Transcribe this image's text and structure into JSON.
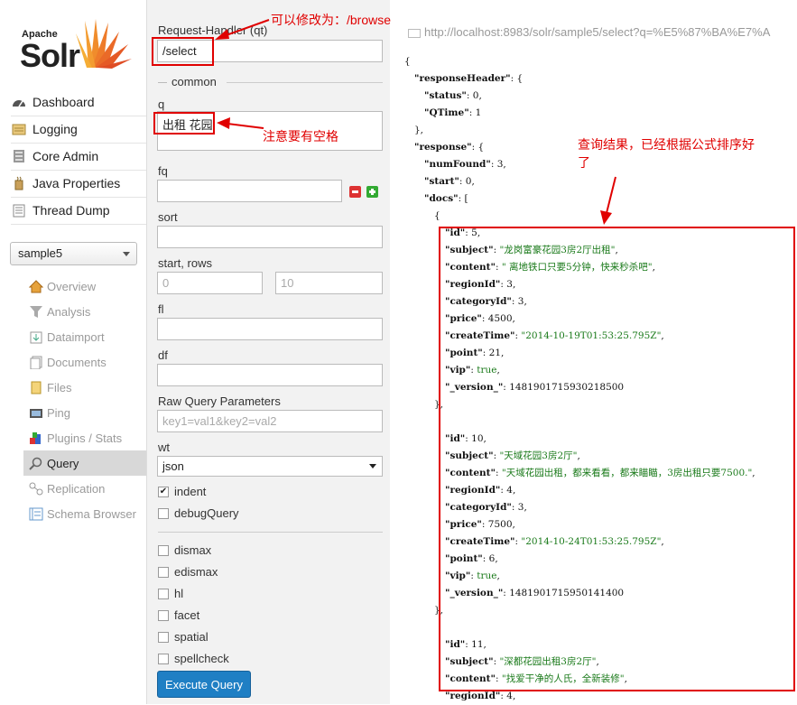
{
  "logo": {
    "top": "Apache",
    "main": "Solr"
  },
  "nav": [
    {
      "label": "Dashboard",
      "icon": "dashboard-icon"
    },
    {
      "label": "Logging",
      "icon": "logging-icon"
    },
    {
      "label": "Core Admin",
      "icon": "core-admin-icon"
    },
    {
      "label": "Java Properties",
      "icon": "java-icon"
    },
    {
      "label": "Thread Dump",
      "icon": "thread-dump-icon"
    }
  ],
  "core_selector": {
    "value": "sample5"
  },
  "core_menu": [
    {
      "label": "Overview",
      "icon": "home-icon"
    },
    {
      "label": "Analysis",
      "icon": "filter-icon"
    },
    {
      "label": "Dataimport",
      "icon": "dataimport-icon"
    },
    {
      "label": "Documents",
      "icon": "documents-icon"
    },
    {
      "label": "Files",
      "icon": "folder-icon"
    },
    {
      "label": "Ping",
      "icon": "ping-icon"
    },
    {
      "label": "Plugins / Stats",
      "icon": "plugins-icon"
    },
    {
      "label": "Query",
      "icon": "search-icon",
      "active": true
    },
    {
      "label": "Replication",
      "icon": "replication-icon"
    },
    {
      "label": "Schema Browser",
      "icon": "schema-icon"
    }
  ],
  "form": {
    "qt_label": "Request-Handler (qt)",
    "qt_value": "/select",
    "common_label": "common",
    "q_label": "q",
    "q_value": "出租 花园",
    "fq_label": "fq",
    "sort_label": "sort",
    "start_rows_label": "start, rows",
    "start_placeholder": "0",
    "rows_placeholder": "10",
    "fl_label": "fl",
    "df_label": "df",
    "raw_label": "Raw Query Parameters",
    "raw_placeholder": "key1=val1&key2=val2",
    "wt_label": "wt",
    "wt_value": "json",
    "indent_label": "indent",
    "debug_label": "debugQuery",
    "dismax_label": "dismax",
    "edismax_label": "edismax",
    "hl_label": "hl",
    "facet_label": "facet",
    "spatial_label": "spatial",
    "spellcheck_label": "spellcheck",
    "execute_label": "Execute Query"
  },
  "response_url": "http://localhost:8983/solr/sample5/select?q=%E5%87%BA%E7%A",
  "json_lines": [
    {
      "indent": 0,
      "parts": [
        [
          "p",
          "{"
        ]
      ]
    },
    {
      "indent": 1,
      "parts": [
        [
          "k",
          "\"responseHeader\""
        ],
        [
          "p",
          ": {"
        ]
      ]
    },
    {
      "indent": 2,
      "parts": [
        [
          "k",
          "\"status\""
        ],
        [
          "p",
          ": "
        ],
        [
          "n",
          "0"
        ],
        [
          "p",
          ","
        ]
      ]
    },
    {
      "indent": 2,
      "parts": [
        [
          "k",
          "\"QTime\""
        ],
        [
          "p",
          ": "
        ],
        [
          "n",
          "1"
        ]
      ]
    },
    {
      "indent": 1,
      "parts": [
        [
          "p",
          "},"
        ]
      ]
    },
    {
      "indent": 1,
      "parts": [
        [
          "k",
          "\"response\""
        ],
        [
          "p",
          ": {"
        ]
      ]
    },
    {
      "indent": 2,
      "parts": [
        [
          "k",
          "\"numFound\""
        ],
        [
          "p",
          ": "
        ],
        [
          "n",
          "3"
        ],
        [
          "p",
          ","
        ]
      ]
    },
    {
      "indent": 2,
      "parts": [
        [
          "k",
          "\"start\""
        ],
        [
          "p",
          ": "
        ],
        [
          "n",
          "0"
        ],
        [
          "p",
          ","
        ]
      ]
    },
    {
      "indent": 2,
      "parts": [
        [
          "k",
          "\"docs\""
        ],
        [
          "p",
          ": ["
        ]
      ]
    },
    {
      "indent": 3,
      "parts": [
        [
          "p",
          "{"
        ]
      ]
    },
    {
      "indent": 4,
      "parts": [
        [
          "k",
          "\"id\""
        ],
        [
          "p",
          ": "
        ],
        [
          "n",
          "5"
        ],
        [
          "p",
          ","
        ]
      ]
    },
    {
      "indent": 4,
      "parts": [
        [
          "k",
          "\"subject\""
        ],
        [
          "p",
          ": "
        ],
        [
          "s",
          "\"龙岗富豪花园3房2厅出租\""
        ],
        [
          "p",
          ","
        ]
      ]
    },
    {
      "indent": 4,
      "parts": [
        [
          "k",
          "\"content\""
        ],
        [
          "p",
          ": "
        ],
        [
          "s",
          "\" 离地铁口只要5分钟，快来秒杀吧\""
        ],
        [
          "p",
          ","
        ]
      ]
    },
    {
      "indent": 4,
      "parts": [
        [
          "k",
          "\"regionId\""
        ],
        [
          "p",
          ": "
        ],
        [
          "n",
          "3"
        ],
        [
          "p",
          ","
        ]
      ]
    },
    {
      "indent": 4,
      "parts": [
        [
          "k",
          "\"categoryId\""
        ],
        [
          "p",
          ": "
        ],
        [
          "n",
          "3"
        ],
        [
          "p",
          ","
        ]
      ]
    },
    {
      "indent": 4,
      "parts": [
        [
          "k",
          "\"price\""
        ],
        [
          "p",
          ": "
        ],
        [
          "n",
          "4500"
        ],
        [
          "p",
          ","
        ]
      ]
    },
    {
      "indent": 4,
      "parts": [
        [
          "k",
          "\"createTime\""
        ],
        [
          "p",
          ": "
        ],
        [
          "s",
          "\"2014-10-19T01:53:25.795Z\""
        ],
        [
          "p",
          ","
        ]
      ]
    },
    {
      "indent": 4,
      "parts": [
        [
          "k",
          "\"point\""
        ],
        [
          "p",
          ": "
        ],
        [
          "n",
          "21"
        ],
        [
          "p",
          ","
        ]
      ]
    },
    {
      "indent": 4,
      "parts": [
        [
          "k",
          "\"vip\""
        ],
        [
          "p",
          ": "
        ],
        [
          "s",
          "true"
        ],
        [
          "p",
          ","
        ]
      ]
    },
    {
      "indent": 4,
      "parts": [
        [
          "k",
          "\"_version_\""
        ],
        [
          "p",
          ": "
        ],
        [
          "n",
          "1481901715930218500"
        ]
      ]
    },
    {
      "indent": 3,
      "parts": [
        [
          "p",
          "},"
        ]
      ]
    },
    {
      "indent": 3,
      "parts": [
        [
          "p",
          ""
        ]
      ]
    },
    {
      "indent": 4,
      "parts": [
        [
          "k",
          "\"id\""
        ],
        [
          "p",
          ": "
        ],
        [
          "n",
          "10"
        ],
        [
          "p",
          ","
        ]
      ]
    },
    {
      "indent": 4,
      "parts": [
        [
          "k",
          "\"subject\""
        ],
        [
          "p",
          ": "
        ],
        [
          "s",
          "\"天域花园3房2厅\""
        ],
        [
          "p",
          ","
        ]
      ]
    },
    {
      "indent": 4,
      "parts": [
        [
          "k",
          "\"content\""
        ],
        [
          "p",
          ": "
        ],
        [
          "s",
          "\"天域花园出租，都来看看，都来瞄瞄，3房出租只要7500.\""
        ],
        [
          "p",
          ","
        ]
      ]
    },
    {
      "indent": 4,
      "parts": [
        [
          "k",
          "\"regionId\""
        ],
        [
          "p",
          ": "
        ],
        [
          "n",
          "4"
        ],
        [
          "p",
          ","
        ]
      ]
    },
    {
      "indent": 4,
      "parts": [
        [
          "k",
          "\"categoryId\""
        ],
        [
          "p",
          ": "
        ],
        [
          "n",
          "3"
        ],
        [
          "p",
          ","
        ]
      ]
    },
    {
      "indent": 4,
      "parts": [
        [
          "k",
          "\"price\""
        ],
        [
          "p",
          ": "
        ],
        [
          "n",
          "7500"
        ],
        [
          "p",
          ","
        ]
      ]
    },
    {
      "indent": 4,
      "parts": [
        [
          "k",
          "\"createTime\""
        ],
        [
          "p",
          ": "
        ],
        [
          "s",
          "\"2014-10-24T01:53:25.795Z\""
        ],
        [
          "p",
          ","
        ]
      ]
    },
    {
      "indent": 4,
      "parts": [
        [
          "k",
          "\"point\""
        ],
        [
          "p",
          ": "
        ],
        [
          "n",
          "6"
        ],
        [
          "p",
          ","
        ]
      ]
    },
    {
      "indent": 4,
      "parts": [
        [
          "k",
          "\"vip\""
        ],
        [
          "p",
          ": "
        ],
        [
          "s",
          "true"
        ],
        [
          "p",
          ","
        ]
      ]
    },
    {
      "indent": 4,
      "parts": [
        [
          "k",
          "\"_version_\""
        ],
        [
          "p",
          ": "
        ],
        [
          "n",
          "1481901715950141400"
        ]
      ]
    },
    {
      "indent": 3,
      "parts": [
        [
          "p",
          "},"
        ]
      ]
    },
    {
      "indent": 3,
      "parts": [
        [
          "p",
          ""
        ]
      ]
    },
    {
      "indent": 4,
      "parts": [
        [
          "k",
          "\"id\""
        ],
        [
          "p",
          ": "
        ],
        [
          "n",
          "11"
        ],
        [
          "p",
          ","
        ]
      ]
    },
    {
      "indent": 4,
      "parts": [
        [
          "k",
          "\"subject\""
        ],
        [
          "p",
          ": "
        ],
        [
          "s",
          "\"深都花园出租3房2厅\""
        ],
        [
          "p",
          ","
        ]
      ]
    },
    {
      "indent": 4,
      "parts": [
        [
          "k",
          "\"content\""
        ],
        [
          "p",
          ": "
        ],
        [
          "s",
          "\"找爱干净的人氏，全新装修\""
        ],
        [
          "p",
          ","
        ]
      ]
    },
    {
      "indent": 4,
      "parts": [
        [
          "k",
          "\"regionId\""
        ],
        [
          "p",
          ": "
        ],
        [
          "n",
          "4"
        ],
        [
          "p",
          ","
        ]
      ]
    }
  ],
  "annotations": {
    "handler_note": "可以修改为：/browse",
    "space_note": "注意要有空格",
    "result_note": "查询结果，已经根据公式排序好了"
  },
  "colors": {
    "annotation": "#e00000",
    "string": "#1a7a1a",
    "execute_button": "#1f7fc4"
  }
}
